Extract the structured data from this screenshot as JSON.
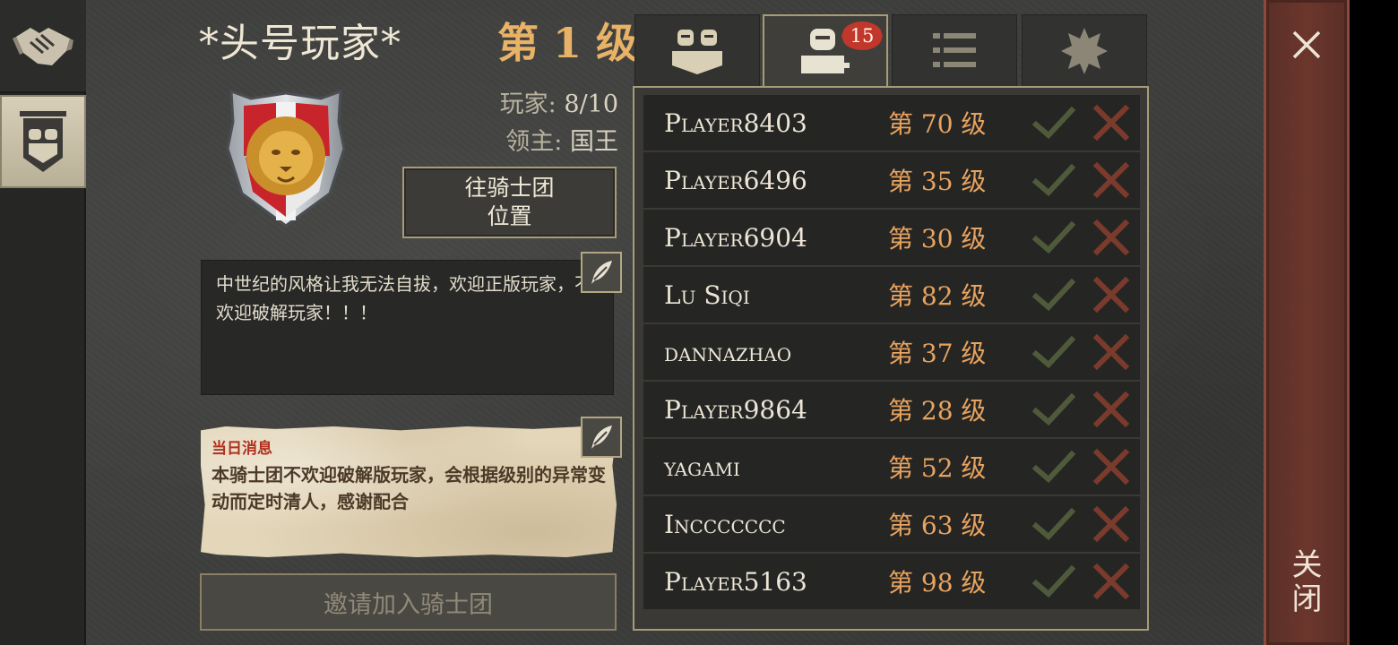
{
  "nav": {
    "items": [
      {
        "id": "alliance",
        "icon": "handshake-icon"
      },
      {
        "id": "guild",
        "icon": "knights-banner-icon",
        "active": true
      }
    ]
  },
  "guild": {
    "name": "*头号玩家*",
    "level": "第 1 级",
    "players_label": "玩家:",
    "players_value": "8/10",
    "lord_label": "领主:",
    "lord_value": "国王",
    "goto_line1": "往骑士团",
    "goto_line2": "位置",
    "description": "中世纪的风格让我无法自拔，欢迎正版玩家，不欢迎破解玩家！！！",
    "daily_title": "当日消息",
    "daily_text": "本骑士团不欢迎破解版玩家，会根据级别的异常变动而定时清人，感谢配合",
    "invite_label": "邀请加入骑士团"
  },
  "tabs": [
    {
      "icon": "members-icon",
      "active": false
    },
    {
      "icon": "join-requests-icon",
      "active": true,
      "badge": "15"
    },
    {
      "icon": "list-icon",
      "active": false
    },
    {
      "icon": "emblem-icon",
      "active": false
    }
  ],
  "requests": [
    {
      "name": "Player8403",
      "level": "第 70 级"
    },
    {
      "name": "Player6496",
      "level": "第 35 级"
    },
    {
      "name": "Player6904",
      "level": "第 30 级"
    },
    {
      "name": "Lu Siqi",
      "level": "第 82 级"
    },
    {
      "name": "dannazhao",
      "level": "第 37 级"
    },
    {
      "name": "Player9864",
      "level": "第 28 级"
    },
    {
      "name": "yagami",
      "level": "第 52 级"
    },
    {
      "name": "Inccccccc",
      "level": "第 63 级"
    },
    {
      "name": "Player5163",
      "level": "第 98 级"
    }
  ],
  "close": {
    "label": "关闭"
  },
  "colors": {
    "accent": "#e8b267",
    "level": "#e8a35f",
    "accept": "#4e5a3a",
    "reject": "#7a3a2c",
    "close_bar": "#6b362c"
  }
}
